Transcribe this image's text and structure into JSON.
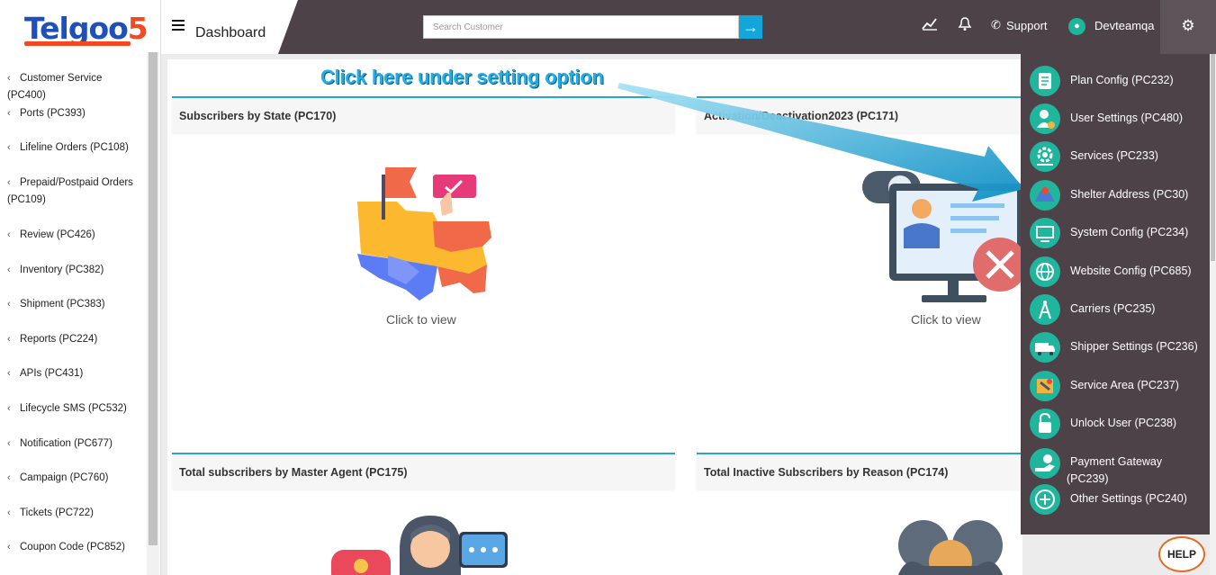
{
  "logo": {
    "text_main": "Telgoo",
    "text_num": "5"
  },
  "sidebar": {
    "items": [
      {
        "label": "Customer Service (PC400)"
      },
      {
        "label": "Ports (PC393)"
      },
      {
        "label": "Lifeline Orders (PC108)"
      },
      {
        "label": "Prepaid/Postpaid Orders (PC109)"
      },
      {
        "label": "Review (PC426)"
      },
      {
        "label": "Inventory (PC382)"
      },
      {
        "label": "Shipment (PC383)"
      },
      {
        "label": "Reports (PC224)"
      },
      {
        "label": "APIs (PC431)"
      },
      {
        "label": "Lifecycle SMS (PC532)"
      },
      {
        "label": "Notification (PC677)"
      },
      {
        "label": "Campaign (PC760)"
      },
      {
        "label": "Tickets (PC722)"
      },
      {
        "label": "Coupon Code (PC852)"
      }
    ]
  },
  "header": {
    "title": "Dashboard",
    "search_placeholder": "Search Customer",
    "support_label": "Support",
    "user_name": "Devteamqa"
  },
  "panels": {
    "p1_title": "Subscribers by State (PC170)",
    "p2_title": "Activation/Deactivation2023 (PC171)",
    "p3_title": "Total subscribers by Master Agent (PC175)",
    "p4_title": "Total Inactive Subscribers by Reason (PC174)",
    "click_to_view": "Click to view"
  },
  "annotation": {
    "callout": "Click here under setting option"
  },
  "settings_menu": {
    "items": [
      {
        "label": "Plan Config (PC232)",
        "icon": "plan-config-icon"
      },
      {
        "label": "User Settings (PC480)",
        "icon": "user-settings-icon"
      },
      {
        "label": "Services (PC233)",
        "icon": "services-icon"
      },
      {
        "label": "Shelter Address (PC30)",
        "icon": "shelter-address-icon"
      },
      {
        "label": "System Config (PC234)",
        "icon": "system-config-icon"
      },
      {
        "label": "Website Config (PC685)",
        "icon": "website-config-icon"
      },
      {
        "label": "Carriers (PC235)",
        "icon": "carriers-icon"
      },
      {
        "label": "Shipper Settings (PC236)",
        "icon": "shipper-icon"
      },
      {
        "label": "Service Area (PC237)",
        "icon": "service-area-icon"
      },
      {
        "label": "Unlock User (PC238)",
        "icon": "unlock-icon"
      },
      {
        "label": "Payment Gateway (PC239)",
        "icon": "payment-icon"
      },
      {
        "label": "Other Settings (PC240)",
        "icon": "plus-icon"
      }
    ]
  },
  "help": {
    "label": "HELP"
  },
  "colors": {
    "topbar": "#4c4248",
    "accent": "#1db59b",
    "brand_blue": "#1f4fb9",
    "brand_orange": "#f04a23"
  }
}
